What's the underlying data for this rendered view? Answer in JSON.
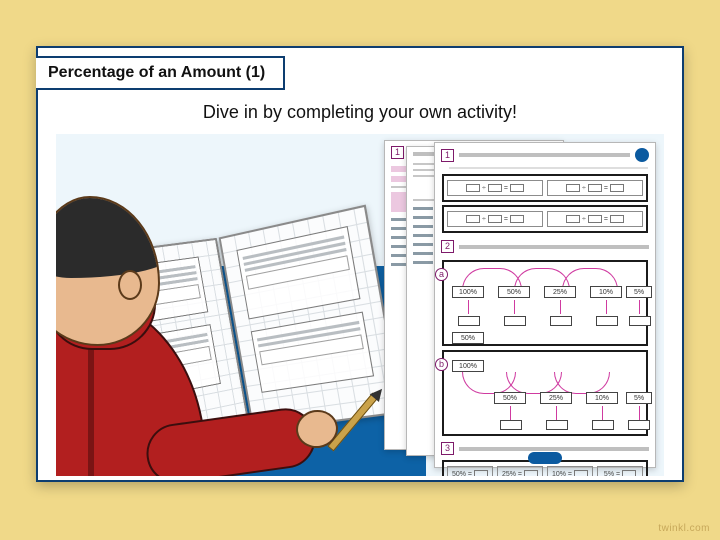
{
  "slide": {
    "title": "Percentage of an Amount (1)",
    "subtitle": "Dive in by completing your own activity!"
  },
  "worksheet": {
    "question_numbers": [
      "1",
      "2",
      "3"
    ],
    "panel_badges": [
      "a",
      "b"
    ],
    "diagram_node_labels": [
      "100%",
      "50%",
      "25%",
      "10%",
      "5%"
    ],
    "strip_cells": [
      "50% =",
      "25% =",
      "10% =",
      "5% ="
    ]
  },
  "brand": {
    "footer": "twinkl.com"
  }
}
